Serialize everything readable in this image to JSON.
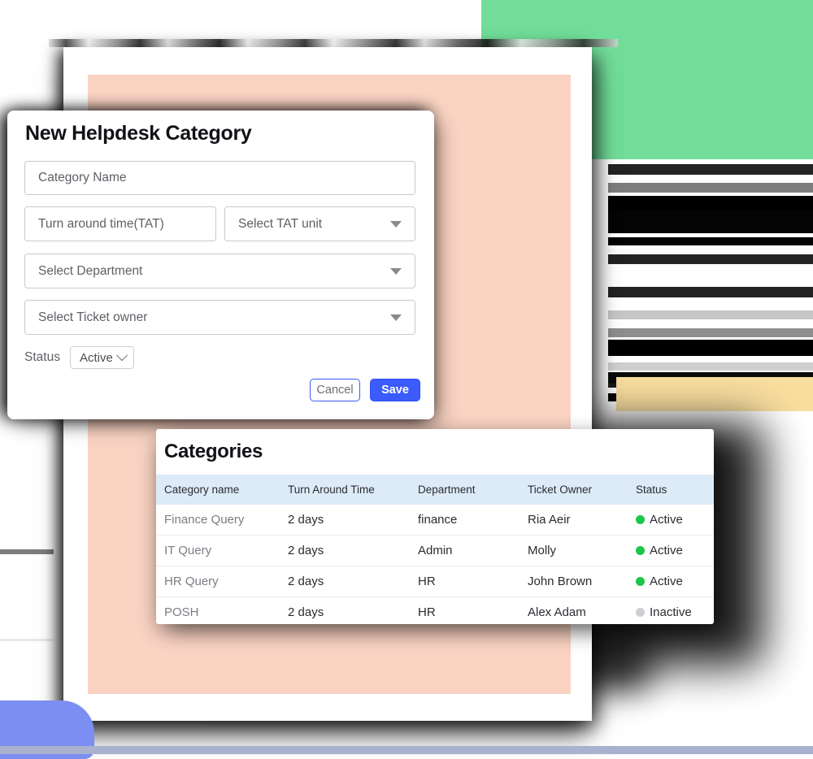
{
  "background": {
    "green_color": "#72dd9a",
    "peach_color": "#fad3c3",
    "yellow_bar_color": "#f8dd9e",
    "blue_blob_color": "#7b8ef2",
    "bottom_bar_color": "#aab1cf"
  },
  "modal": {
    "title": "New Helpdesk Category",
    "fields": [
      {
        "name": "category-name",
        "placeholder": "Category Name",
        "type": "text"
      },
      {
        "name": "turn-around-time",
        "placeholder": "Turn around time(TAT)",
        "type": "text"
      },
      {
        "name": "tat-unit",
        "placeholder": "Select TAT unit",
        "type": "select"
      },
      {
        "name": "department",
        "placeholder": "Select Department",
        "type": "select"
      },
      {
        "name": "ticket-owner",
        "placeholder": "Select Ticket owner",
        "type": "select"
      }
    ],
    "status": {
      "label": "Status",
      "value": "Active"
    },
    "buttons": {
      "cancel": "Cancel",
      "save": "Save"
    },
    "accent_color": "#3b5bfd"
  },
  "table": {
    "title": "Categories",
    "header_background": "#ddeaf8",
    "columns": [
      "Category name",
      "Turn Around Time",
      "Department",
      "Ticket Owner",
      "Status"
    ],
    "rows": [
      {
        "category_name": "Finance Query",
        "turn_around_time": "2 days",
        "department": "finance",
        "ticket_owner": "Ria Aeir",
        "status": "Active",
        "status_color": "#1bc64a"
      },
      {
        "category_name": "IT Query",
        "turn_around_time": "2 days",
        "department": "Admin",
        "ticket_owner": "Molly",
        "status": "Active",
        "status_color": "#1bc64a"
      },
      {
        "category_name": "HR Query",
        "turn_around_time": "2 days",
        "department": "HR",
        "ticket_owner": "John Brown",
        "status": "Active",
        "status_color": "#1bc64a"
      },
      {
        "category_name": "POSH",
        "turn_around_time": "2 days",
        "department": "HR",
        "ticket_owner": "Alex Adam",
        "status": "Inactive",
        "status_color": "#cdcfd3"
      }
    ]
  }
}
